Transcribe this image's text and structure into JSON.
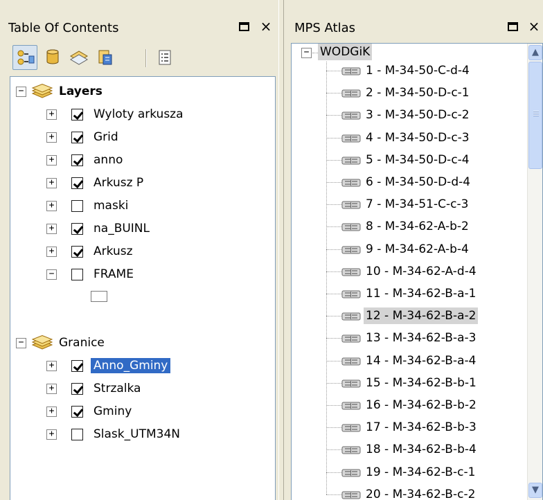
{
  "toc": {
    "title": "Table Of Contents",
    "restore_glyph": "restore-icon",
    "close_glyph": "×",
    "toolbar": [
      "list-by-drawing-order-icon",
      "list-by-source-icon",
      "list-by-visibility-icon",
      "list-by-selection-icon",
      "options-icon"
    ],
    "groups": [
      {
        "label": "Layers",
        "bold": true,
        "expanded": true,
        "layers": [
          {
            "label": "Wyloty arkusza",
            "checked": true,
            "expanded": false
          },
          {
            "label": "Grid",
            "checked": true,
            "expanded": false
          },
          {
            "label": "anno",
            "checked": true,
            "expanded": false
          },
          {
            "label": "Arkusz P",
            "checked": true,
            "expanded": false
          },
          {
            "label": "maski",
            "checked": false,
            "expanded": false
          },
          {
            "label": "na_BUINL",
            "checked": true,
            "expanded": false
          },
          {
            "label": "Arkusz",
            "checked": true,
            "expanded": false
          },
          {
            "label": "FRAME",
            "checked": false,
            "expanded": true
          }
        ]
      },
      {
        "label": "Granice",
        "bold": false,
        "expanded": true,
        "layers": [
          {
            "label": "Anno_Gminy",
            "checked": true,
            "expanded": false,
            "selected": true
          },
          {
            "label": "Strzalka",
            "checked": true,
            "expanded": false
          },
          {
            "label": "Gminy",
            "checked": true,
            "expanded": false
          },
          {
            "label": "Slask_UTM34N",
            "checked": false,
            "expanded": false
          }
        ]
      }
    ],
    "expander_plus": "+",
    "expander_minus": "−"
  },
  "atlas": {
    "title": "MPS Atlas",
    "close_glyph": "×",
    "root": {
      "label": "WODGiK",
      "expander": "−"
    },
    "pages": [
      "1 - M-34-50-C-d-4",
      "2 - M-34-50-D-c-1",
      "3 - M-34-50-D-c-2",
      "4 - M-34-50-D-c-3",
      "5 - M-34-50-D-c-4",
      "6 - M-34-50-D-d-4",
      "7 - M-34-51-C-c-3",
      "8 - M-34-62-A-b-2",
      "9 - M-34-62-A-b-4",
      "10 - M-34-62-A-d-4",
      "11 - M-34-62-B-a-1",
      "12 - M-34-62-B-a-2",
      "13 - M-34-62-B-a-3",
      "14 - M-34-62-B-a-4",
      "15 - M-34-62-B-b-1",
      "16 - M-34-62-B-b-2",
      "17 - M-34-62-B-b-3",
      "18 - M-34-62-B-b-4",
      "19 - M-34-62-B-c-1",
      "20 - M-34-62-B-c-2"
    ],
    "highlighted_page": "12 - M-34-62-B-a-2",
    "scroll_up_glyph": "▲",
    "scroll_down_glyph": "▼"
  },
  "colors": {
    "selection": "#316ac5",
    "highlight": "#d4d4d4",
    "panel_bg": "#ece9d8",
    "border": "#7f9db9"
  }
}
